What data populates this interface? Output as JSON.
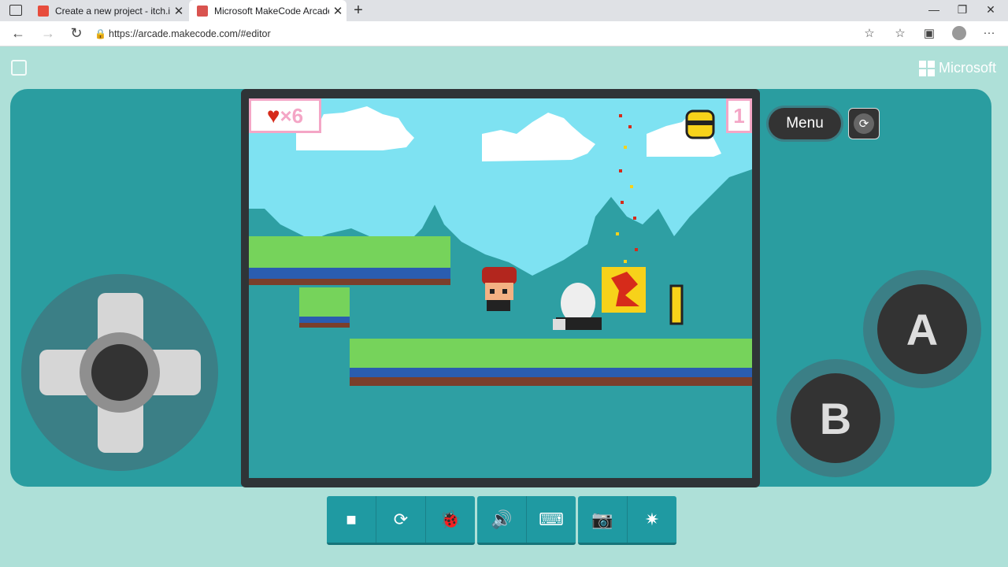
{
  "browser": {
    "tabs": [
      {
        "title": "Create a new project - itch.io",
        "color": "#e74c3c"
      },
      {
        "title": "Microsoft MakeCode Arcade",
        "color": "#d9534f"
      }
    ],
    "url": "https://arcade.makecode.com/#editor",
    "icons": {
      "back": "←",
      "forward": "→",
      "refresh": "↻",
      "newtab": "+",
      "minimize": "—",
      "maximize": "❐",
      "close": "✕",
      "favorite": "☆",
      "favorites": "☆",
      "collections": "▣",
      "more": "···"
    }
  },
  "brand": {
    "name": "Microsoft"
  },
  "game": {
    "lives_symbol": "×6",
    "score": "1",
    "colors": {
      "sky": "#7ee2f2",
      "mountain": "#2e9fa3",
      "grass": "#76d35b",
      "screen_frame": "#2f3437"
    }
  },
  "controls": {
    "menu_label": "Menu",
    "restart_symbol": "⟳",
    "a_label": "A",
    "b_label": "B"
  },
  "toolbar": {
    "stop": "■",
    "restart": "⟳",
    "debug": "🐞",
    "mute": "🔊",
    "keyboard": "⌨",
    "screenshot": "📷",
    "record": "✷"
  }
}
